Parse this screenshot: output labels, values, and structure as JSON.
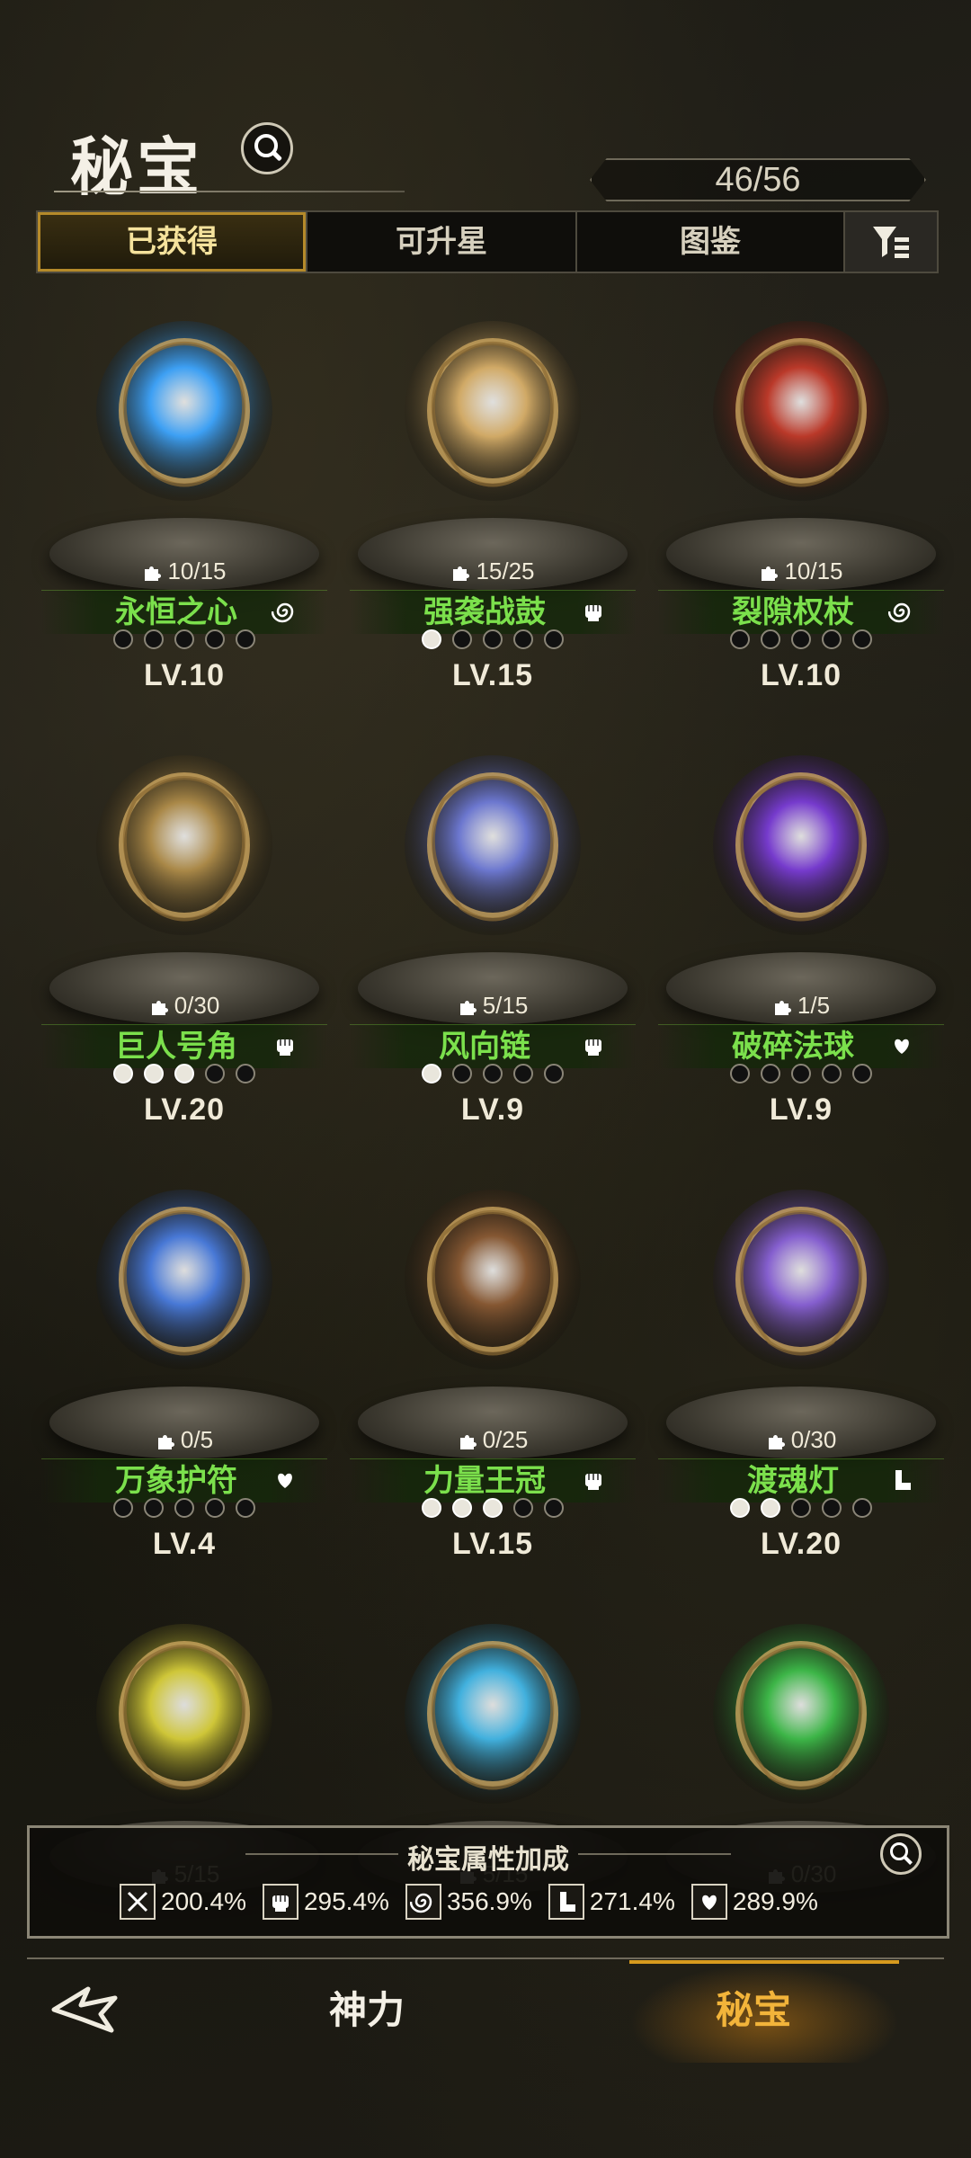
{
  "header": {
    "title": "秘宝",
    "count": "46/56"
  },
  "tabs": [
    {
      "label": "已获得",
      "active": true
    },
    {
      "label": "可升星",
      "active": false
    },
    {
      "label": "图鉴",
      "active": false
    }
  ],
  "items": [
    {
      "name": "永恒之心",
      "shards": "10/15",
      "level": "LV.10",
      "stars": 0,
      "type_icon": "swirl-icon",
      "color": "#3ea6ff"
    },
    {
      "name": "强袭战鼓",
      "shards": "15/25",
      "level": "LV.15",
      "stars": 1,
      "type_icon": "fist-icon",
      "color": "#d9b06a"
    },
    {
      "name": "裂隙权杖",
      "shards": "10/15",
      "level": "LV.10",
      "stars": 0,
      "type_icon": "swirl-icon",
      "color": "#c23a2a"
    },
    {
      "name": "巨人号角",
      "shards": "0/30",
      "level": "LV.20",
      "stars": 3,
      "type_icon": "fist-icon",
      "color": "#b08d4a"
    },
    {
      "name": "风向链",
      "shards": "5/15",
      "level": "LV.9",
      "stars": 1,
      "type_icon": "fist-icon",
      "color": "#6f7bd8"
    },
    {
      "name": "破碎法球",
      "shards": "1/5",
      "level": "LV.9",
      "stars": 0,
      "type_icon": "heart-hand-icon",
      "color": "#7a3cd6"
    },
    {
      "name": "万象护符",
      "shards": "0/5",
      "level": "LV.4",
      "stars": 0,
      "type_icon": "heart-hand-icon",
      "color": "#4a7de0"
    },
    {
      "name": "力量王冠",
      "shards": "0/25",
      "level": "LV.15",
      "stars": 3,
      "type_icon": "fist-icon",
      "color": "#8a5a34"
    },
    {
      "name": "渡魂灯",
      "shards": "0/30",
      "level": "LV.20",
      "stars": 2,
      "type_icon": "boot-icon",
      "color": "#8a62d8"
    },
    {
      "name": "",
      "shards": "5/15",
      "level": "",
      "stars": null,
      "type_icon": "",
      "color": "#d8cf3a"
    },
    {
      "name": "",
      "shards": "5/15",
      "level": "",
      "stars": null,
      "type_icon": "",
      "color": "#43b8e8"
    },
    {
      "name": "",
      "shards": "0/30",
      "level": "",
      "stars": null,
      "type_icon": "",
      "color": "#3ebd4a"
    }
  ],
  "attributes": {
    "title": "秘宝属性加成",
    "values": [
      {
        "icon": "sword-icon",
        "value": "200.4%"
      },
      {
        "icon": "fist-icon",
        "value": "295.4%"
      },
      {
        "icon": "swirl-icon",
        "value": "356.9%"
      },
      {
        "icon": "boot-icon",
        "value": "271.4%"
      },
      {
        "icon": "heart-hand-icon",
        "value": "289.9%"
      }
    ]
  },
  "nav": {
    "tab1": "神力",
    "tab2": "秘宝",
    "active": "秘宝"
  },
  "accent": "#d79a1e",
  "name_color": "#7be04c"
}
